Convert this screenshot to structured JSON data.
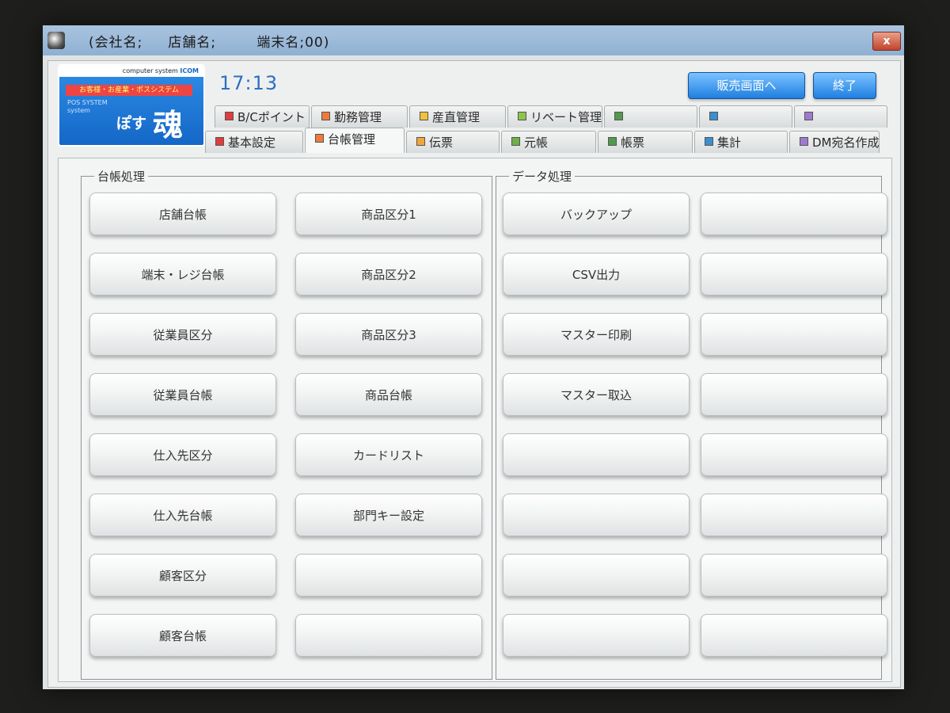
{
  "window": {
    "title": "(会社名;     店舗名;        端末名;00)",
    "close_label": "x"
  },
  "logo": {
    "top_text": "computer system",
    "brand": "ICOM",
    "red_strip": "お客様・お産業・ポスシステム",
    "small_line1": "POS SYSTEM",
    "small_line2": "system",
    "pos_text": "ぽす",
    "main_char": "魂"
  },
  "header": {
    "clock": "17:13",
    "sales_button": "販売画面へ",
    "exit_button": "終了"
  },
  "tabs": {
    "row1": [
      {
        "label": "B/Cポイント",
        "color": "#e23b3b"
      },
      {
        "label": "勤務管理",
        "color": "#f07a3a"
      },
      {
        "label": "産直管理",
        "color": "#f1c23a"
      },
      {
        "label": "リベート管理",
        "color": "#8fc54a"
      },
      {
        "label": "",
        "color": "#4f9a4f"
      },
      {
        "label": "",
        "color": "#3b8fd0"
      },
      {
        "label": "",
        "color": "#a07ad0"
      }
    ],
    "row2": [
      {
        "label": "基本設定",
        "color": "#e23b3b"
      },
      {
        "label": "台帳管理",
        "color": "#f07a3a"
      },
      {
        "label": "伝票",
        "color": "#f1a53a"
      },
      {
        "label": "元帳",
        "color": "#6fb04a"
      },
      {
        "label": "帳票",
        "color": "#4f9a4f"
      },
      {
        "label": "集計",
        "color": "#3b8fd0"
      },
      {
        "label": "DM宛名作成",
        "color": "#a07ad0"
      }
    ]
  },
  "ledger_group": {
    "legend": "台帳処理",
    "col1": [
      "店舗台帳",
      "端末・レジ台帳",
      "従業員区分",
      "従業員台帳",
      "仕入先区分",
      "仕入先台帳",
      "顧客区分",
      "顧客台帳"
    ],
    "col2": [
      "商品区分1",
      "商品区分2",
      "商品区分3",
      "商品台帳",
      "カードリスト",
      "部門キー設定",
      "",
      ""
    ]
  },
  "data_group": {
    "legend": "データ処理",
    "col1": [
      "バックアップ",
      "CSV出力",
      "マスター印刷",
      "マスター取込",
      "",
      "",
      "",
      ""
    ],
    "col2": [
      "",
      "",
      "",
      "",
      "",
      "",
      "",
      ""
    ]
  }
}
